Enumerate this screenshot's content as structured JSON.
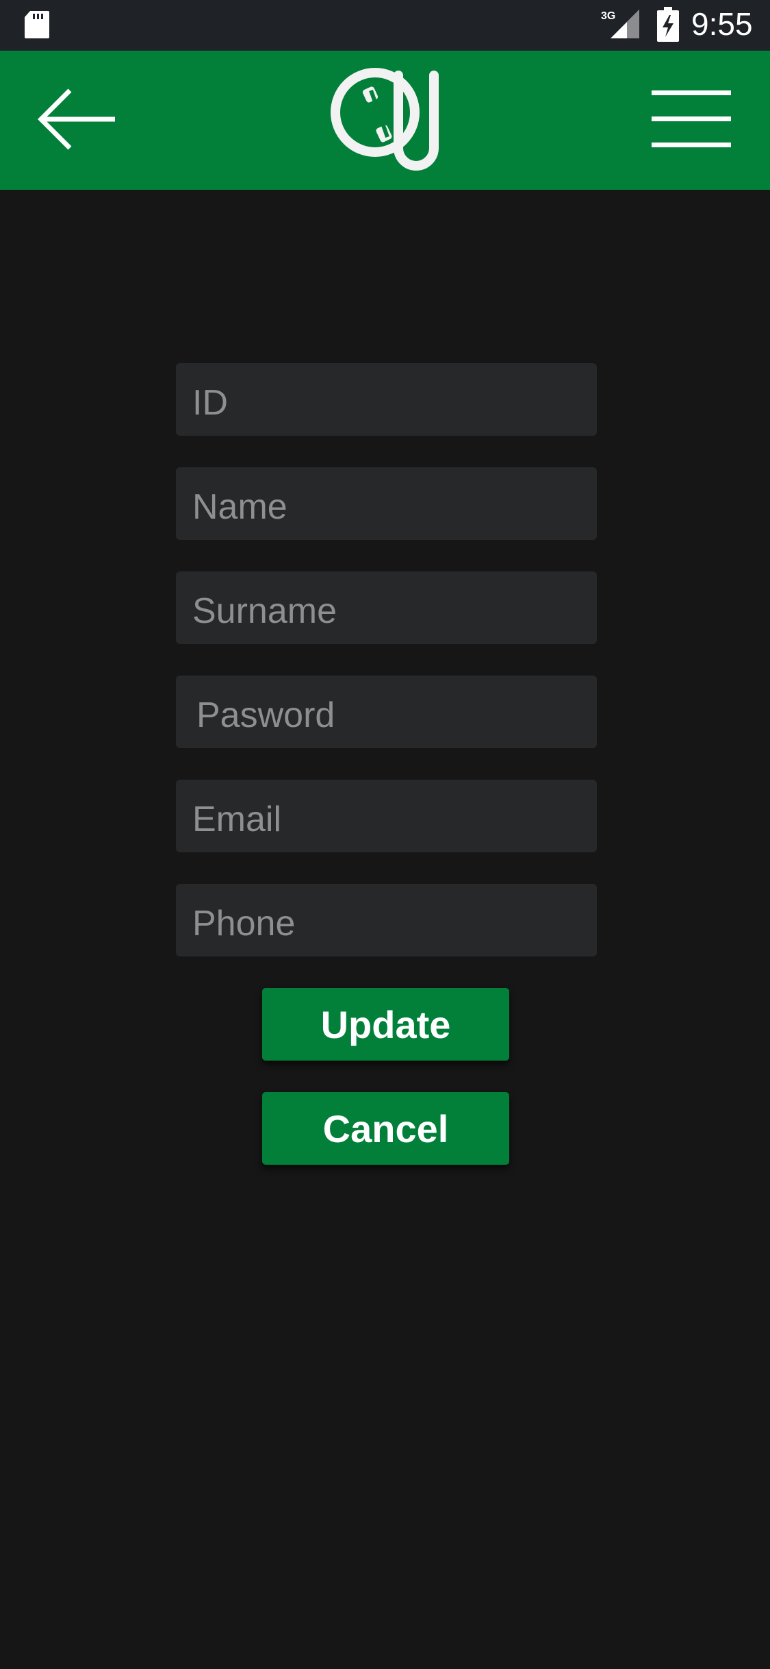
{
  "status_bar": {
    "time": "9:55",
    "network_label": "3G",
    "icons": [
      "sd-card-icon",
      "signal-3g-icon",
      "battery-charging-icon"
    ]
  },
  "app_bar": {
    "background": "#02803a",
    "icons": [
      "back-arrow-icon",
      "app-logo",
      "hamburger-menu-icon"
    ]
  },
  "form": {
    "fields": [
      {
        "name": "id",
        "placeholder": "ID",
        "value": ""
      },
      {
        "name": "name",
        "placeholder": "Name",
        "value": ""
      },
      {
        "name": "surname",
        "placeholder": "Surname",
        "value": ""
      },
      {
        "name": "password",
        "placeholder": "Pasword",
        "value": ""
      },
      {
        "name": "email",
        "placeholder": "Email",
        "value": ""
      },
      {
        "name": "phone",
        "placeholder": "Phone",
        "value": ""
      }
    ],
    "update_label": "Update",
    "cancel_label": "Cancel"
  },
  "colors": {
    "accent": "#02803a",
    "background": "#161617",
    "field_background": "#27282a",
    "placeholder": "#8e8f91"
  }
}
